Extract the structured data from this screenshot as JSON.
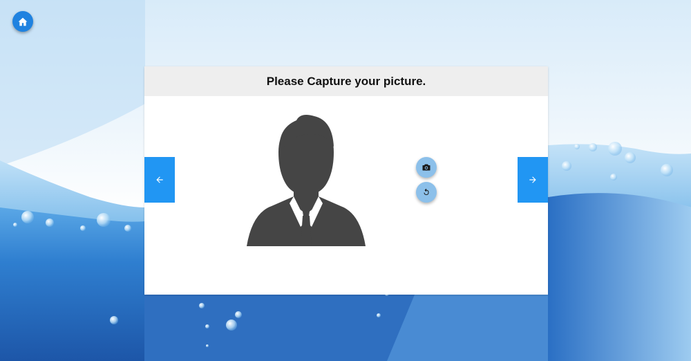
{
  "header": {
    "title": "Please Capture your picture."
  },
  "icons": {
    "home": "home-icon",
    "prev": "arrow-left-icon",
    "next": "arrow-right-icon",
    "capture": "camera-icon",
    "retake": "refresh-icon",
    "avatar": "person-silhouette-icon"
  },
  "colors": {
    "accent": "#2196f3",
    "home_button": "#1f82e0",
    "round_button": "#8cc0ea",
    "avatar": "#454545",
    "header_bg": "#eeeeee"
  }
}
